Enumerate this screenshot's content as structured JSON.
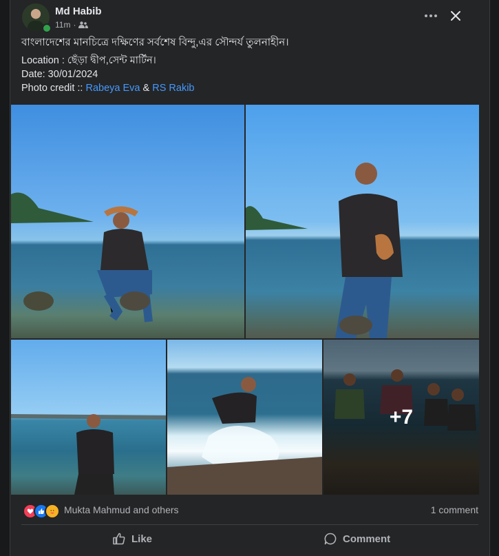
{
  "post": {
    "author": "Md Habib",
    "time": "11m",
    "text_line1": "বাংলাদেশের মানচিত্রে দক্ষিণের সর্বশেষ বিন্দু,এর সৌন্দর্য তুলনাহীন।",
    "location_line": "Location :  ছেঁড়া দ্বীপ,সেন্ট মার্টিন।",
    "date_line": "Date: 30/01/2024",
    "credit_prefix": "Photo credit :: ",
    "credit_name1": "Rabeya Eva",
    "credit_and": " & ",
    "credit_name2": "RS Rakib"
  },
  "photos": {
    "more_count": "+7"
  },
  "reactions": {
    "summary": "Mukta Mahmud and others",
    "comments": "1 comment",
    "icons": [
      "love-icon",
      "like-icon",
      "care-icon"
    ]
  },
  "actions": {
    "like_label": "Like",
    "comment_label": "Comment"
  },
  "colors": {
    "background": "#18191a",
    "card": "#242526",
    "link": "#4599ff",
    "online": "#31a24c"
  }
}
